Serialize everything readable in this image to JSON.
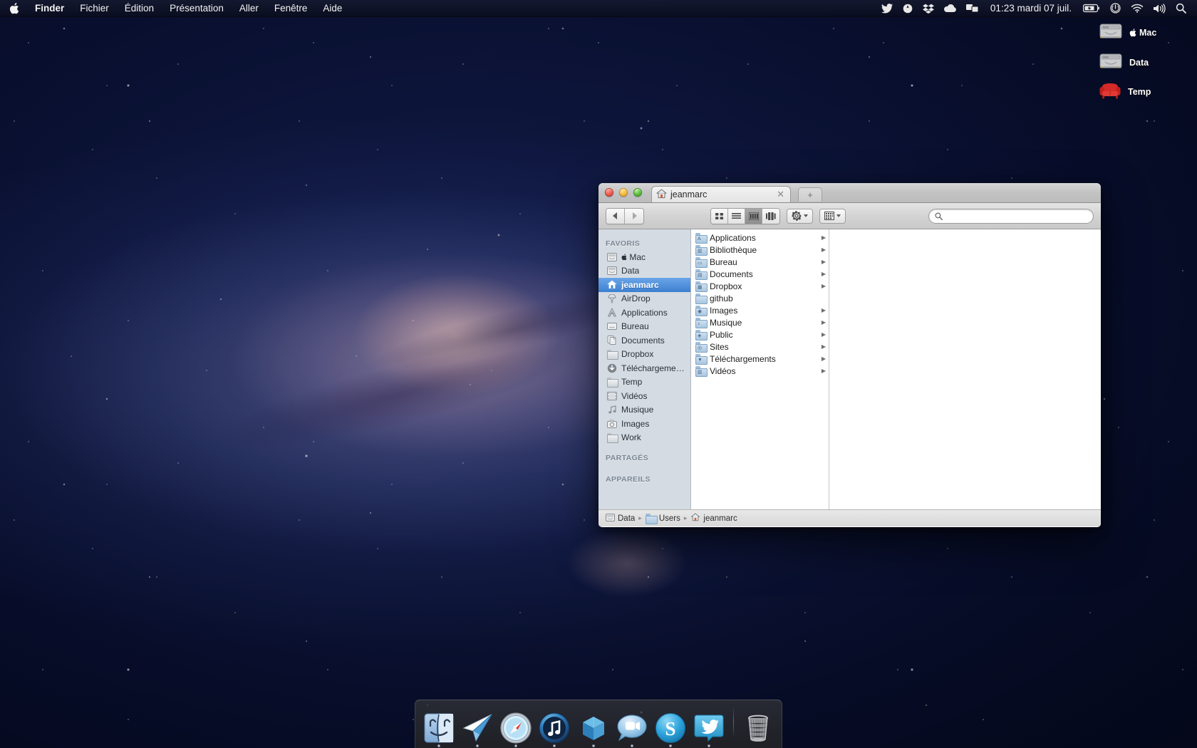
{
  "menubar": {
    "apple_icon": "apple-logo",
    "items": [
      {
        "label": "Finder",
        "bold": true
      },
      {
        "label": "Fichier",
        "bold": false
      },
      {
        "label": "Édition",
        "bold": false
      },
      {
        "label": "Présentation",
        "bold": false
      },
      {
        "label": "Aller",
        "bold": false
      },
      {
        "label": "Fenêtre",
        "bold": false
      },
      {
        "label": "Aide",
        "bold": false
      }
    ],
    "status_icons": [
      "twitter-icon",
      "location-icon",
      "dropbox-icon",
      "cloud-icon",
      "display-icon"
    ],
    "clock": "01:23   mardi 07 juil.",
    "right_icons": [
      "battery-icon",
      "power-icon",
      "wifi-icon",
      "volume-icon",
      "spotlight-icon"
    ]
  },
  "desktop": {
    "icons": [
      {
        "name": "Mac",
        "type": "hard-drive",
        "prefix": "apple-logo"
      },
      {
        "name": "Data",
        "type": "hard-drive",
        "prefix": ""
      },
      {
        "name": "Temp",
        "type": "armchair",
        "prefix": ""
      }
    ]
  },
  "finder": {
    "tab_title": "jeanmarc",
    "tab_close": "✕",
    "new_tab": "+",
    "toolbar": {
      "back": "◀",
      "forward": "▶",
      "view_icon": "icon-view",
      "view_list": "list-view",
      "view_column": "column-view",
      "view_coverflow": "coverflow-view",
      "action_label": "gear-icon",
      "arrange_label": "arrange-icon",
      "search_placeholder": ""
    },
    "sidebar": {
      "sections": [
        {
          "header": "FAVORIS",
          "items": [
            {
              "label": "Mac",
              "icon": "hard-drive-icon",
              "prefix": "apple-logo",
              "selected": false
            },
            {
              "label": "Data",
              "icon": "hard-drive-icon",
              "prefix": "",
              "selected": false
            },
            {
              "label": "jeanmarc",
              "icon": "home-icon",
              "prefix": "",
              "selected": true
            },
            {
              "label": "AirDrop",
              "icon": "airdrop-icon",
              "prefix": "",
              "selected": false
            },
            {
              "label": "Applications",
              "icon": "applications-icon",
              "prefix": "",
              "selected": false
            },
            {
              "label": "Bureau",
              "icon": "desktop-icon",
              "prefix": "",
              "selected": false
            },
            {
              "label": "Documents",
              "icon": "documents-icon",
              "prefix": "",
              "selected": false
            },
            {
              "label": "Dropbox",
              "icon": "folder-icon",
              "prefix": "",
              "selected": false
            },
            {
              "label": "Téléchargeme…",
              "icon": "downloads-icon",
              "prefix": "",
              "selected": false
            },
            {
              "label": "Temp",
              "icon": "folder-icon",
              "prefix": "",
              "selected": false
            },
            {
              "label": "Vidéos",
              "icon": "movies-icon",
              "prefix": "",
              "selected": false
            },
            {
              "label": "Musique",
              "icon": "music-icon",
              "prefix": "",
              "selected": false
            },
            {
              "label": "Images",
              "icon": "pictures-icon",
              "prefix": "",
              "selected": false
            },
            {
              "label": "Work",
              "icon": "folder-icon",
              "prefix": "",
              "selected": false
            }
          ]
        },
        {
          "header": "PARTAGÉS",
          "items": []
        },
        {
          "header": "APPAREILS",
          "items": []
        }
      ]
    },
    "files": [
      {
        "name": "Applications",
        "glyph": "A",
        "has_arrow": true
      },
      {
        "name": "Bibliothèque",
        "glyph": "▥",
        "has_arrow": true
      },
      {
        "name": "Bureau",
        "glyph": "▭",
        "has_arrow": true
      },
      {
        "name": "Documents",
        "glyph": "▤",
        "has_arrow": true
      },
      {
        "name": "Dropbox",
        "glyph": "▦",
        "has_arrow": true
      },
      {
        "name": "github",
        "glyph": "",
        "has_arrow": false
      },
      {
        "name": "Images",
        "glyph": "◉",
        "has_arrow": true
      },
      {
        "name": "Musique",
        "glyph": "♪",
        "has_arrow": true
      },
      {
        "name": "Public",
        "glyph": "◈",
        "has_arrow": true
      },
      {
        "name": "Sites",
        "glyph": "◎",
        "has_arrow": true
      },
      {
        "name": "Téléchargements",
        "glyph": "▼",
        "has_arrow": true
      },
      {
        "name": "Vidéos",
        "glyph": "▥",
        "has_arrow": true
      }
    ],
    "path_bar": [
      {
        "label": "Data",
        "icon": "hard-drive-icon"
      },
      {
        "label": "Users",
        "icon": "folder-icon"
      },
      {
        "label": "jeanmarc",
        "icon": "home-icon"
      }
    ],
    "path_sep": "▸"
  },
  "dock": {
    "apps": [
      {
        "name": "Finder",
        "icon": "finder-icon",
        "running": true
      },
      {
        "name": "Sparrow",
        "icon": "sparrow-icon",
        "running": true
      },
      {
        "name": "Safari",
        "icon": "safari-icon",
        "running": true
      },
      {
        "name": "iTunes",
        "icon": "itunes-icon",
        "running": true
      },
      {
        "name": "Transmit",
        "icon": "cube-icon",
        "running": true
      },
      {
        "name": "FaceTime",
        "icon": "facetime-icon",
        "running": true
      },
      {
        "name": "Skype",
        "icon": "skype-icon",
        "running": true
      },
      {
        "name": "Twitter",
        "icon": "twitter-icon",
        "running": true
      }
    ],
    "trash": {
      "name": "Corbeille",
      "icon": "trash-icon"
    }
  },
  "colors": {
    "selection_blue": "#3d7fd0",
    "sidebar_bg": "#d5dbe3",
    "folder_blue": "#a8c6e0",
    "menubar_bg": "#0a0d1e"
  }
}
